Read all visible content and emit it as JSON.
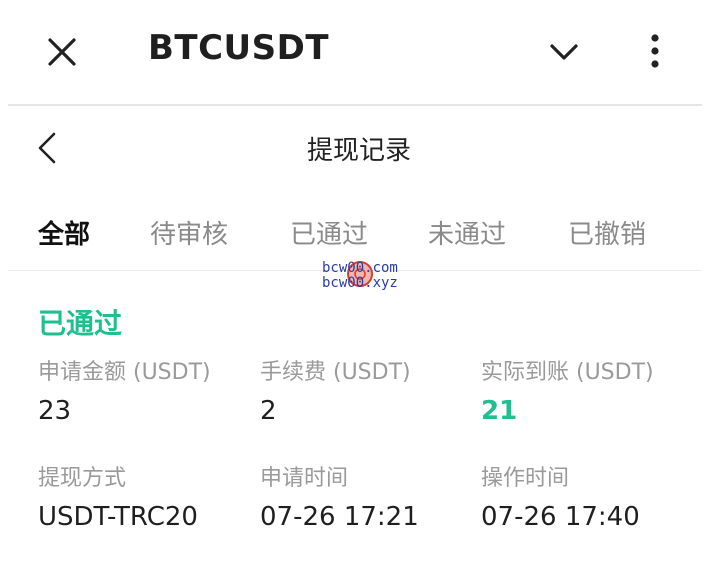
{
  "header": {
    "title": "BTCUSDT"
  },
  "page": {
    "title": "提现记录"
  },
  "tabs": [
    {
      "label": "全部",
      "active": true
    },
    {
      "label": "待审核",
      "active": false
    },
    {
      "label": "已通过",
      "active": false
    },
    {
      "label": "未通过",
      "active": false
    },
    {
      "label": "已撤销",
      "active": false
    }
  ],
  "watermark": {
    "line1": "bcw00.com",
    "line2": "bcw00.xyz"
  },
  "record": {
    "status": "已通过",
    "fields": [
      {
        "label": "申请金额 (USDT)",
        "value": "23"
      },
      {
        "label": "手续费 (USDT)",
        "value": "2"
      },
      {
        "label": "实际到账 (USDT)",
        "value": "21"
      },
      {
        "label": "提现方式",
        "value": "USDT-TRC20"
      },
      {
        "label": "申请时间",
        "value": "07-26 17:21"
      },
      {
        "label": "操作时间",
        "value": "07-26 17:40"
      }
    ]
  },
  "colors": {
    "accent_green": "#1fbf8f",
    "text_primary": "#1f1f1f",
    "text_secondary": "#9a9a9a"
  },
  "icons": {
    "close": "close-icon",
    "dropdown": "chevron-down-icon",
    "more": "more-vertical-icon",
    "back": "chevron-left-icon"
  }
}
